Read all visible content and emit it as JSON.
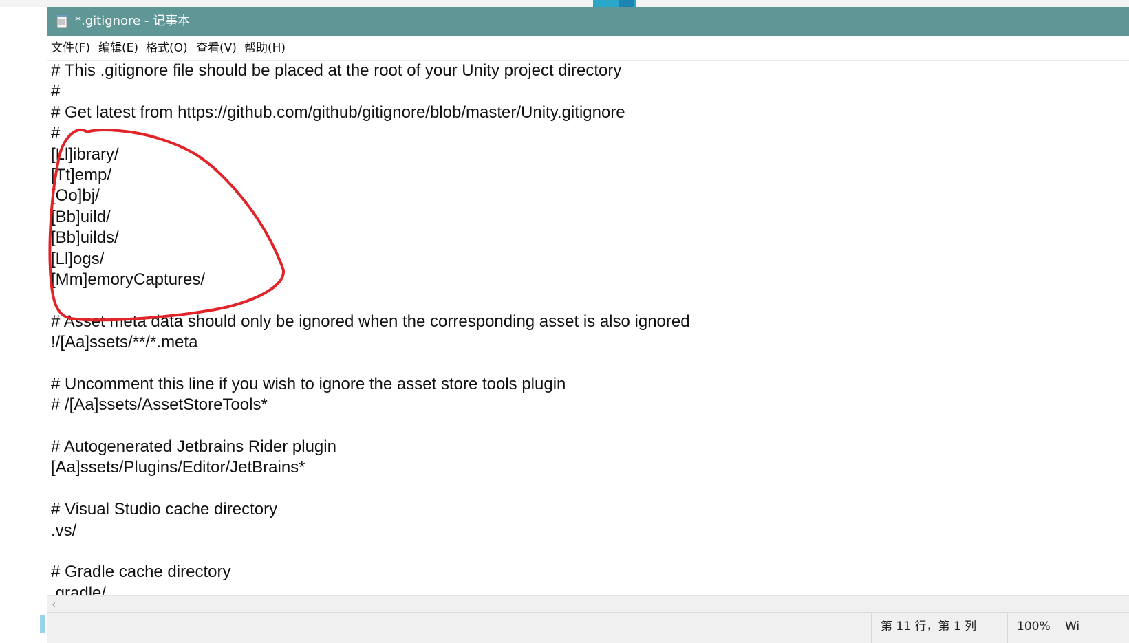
{
  "window": {
    "title": "*.gitignore - 记事本"
  },
  "menu": {
    "items": [
      {
        "label": "文件(F)"
      },
      {
        "label": "编辑(E)"
      },
      {
        "label": "格式(O)"
      },
      {
        "label": "查看(V)"
      },
      {
        "label": "帮助(H)"
      }
    ]
  },
  "editor": {
    "lines": [
      "# This .gitignore file should be placed at the root of your Unity project directory",
      "#",
      "# Get latest from https://github.com/github/gitignore/blob/master/Unity.gitignore",
      "#",
      "[Ll]ibrary/",
      "[Tt]emp/",
      "[Oo]bj/",
      "[Bb]uild/",
      "[Bb]uilds/",
      "[Ll]ogs/",
      "[Mm]emoryCaptures/",
      "",
      "# Asset meta data should only be ignored when the corresponding asset is also ignored",
      "!/[Aa]ssets/**/*.meta",
      "",
      "# Uncomment this line if you wish to ignore the asset store tools plugin",
      "# /[Aa]ssets/AssetStoreTools*",
      "",
      "# Autogenerated Jetbrains Rider plugin",
      "[Aa]ssets/Plugins/Editor/JetBrains*",
      "",
      "# Visual Studio cache directory",
      ".vs/",
      "",
      "# Gradle cache directory",
      ".gradle/"
    ]
  },
  "statusbar": {
    "position": "第 11 行，第 1 列",
    "zoom": "100%",
    "line_ending": "Wi"
  },
  "colors": {
    "titlebar": "#5f9796",
    "annotation": "#e0242a"
  }
}
